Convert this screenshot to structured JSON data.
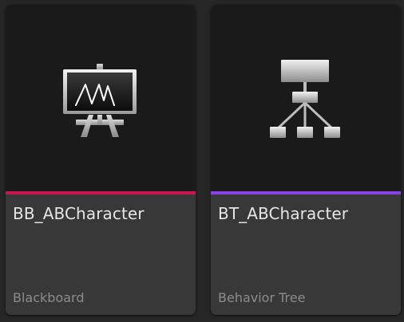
{
  "assets": [
    {
      "name": "BB_ABCharacter",
      "type_label": "Blackboard",
      "icon": "blackboard-easel-icon",
      "accent_color": "#c9174f"
    },
    {
      "name": "BT_ABCharacter",
      "type_label": "Behavior Tree",
      "icon": "behavior-tree-hierarchy-icon",
      "accent_color": "#8a3fe8"
    }
  ],
  "colors": {
    "background": "#262626",
    "thumbnail": "#1a1a1a",
    "info_panel": "#383838"
  }
}
